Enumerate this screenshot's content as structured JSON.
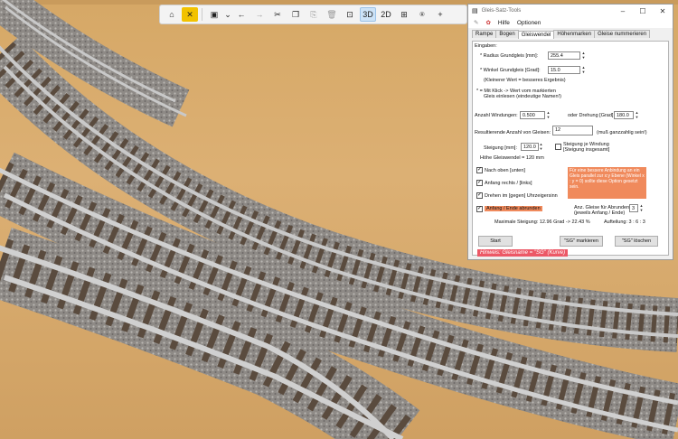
{
  "toolbar": {
    "buttons": [
      "home-icon",
      "tools-icon",
      "save-icon",
      "chevron-down-icon",
      "undo-arrow-icon",
      "redo-arrow-icon",
      "cut-icon",
      "copy-icon",
      "paste-icon",
      "chevron-down-icon",
      "delete-icon",
      "snap-icon"
    ],
    "view_3d": "3D",
    "view_2d": "2D",
    "accent": "#f2c200"
  },
  "window": {
    "title": "Gleis-Satz-Tools",
    "menu": [
      "Hilfe",
      "Optionen"
    ],
    "tabs": [
      "Rampe",
      "Bogen",
      "Gleiswendel",
      "Höhenmarken",
      "Gleise nummerieren"
    ],
    "active_tab": "Gleiswendel"
  },
  "form": {
    "eingaben": "Eingaben:",
    "radius_label": "* Radius Grundgleis [mm]:",
    "radius_value": "255.4",
    "winkel_label": "* Winkel Grundgleis [Grad]:",
    "winkel_value": "15.0",
    "winkel_hint": "(Kleinerer  Wert = besseres Ergebnis)",
    "klick_hint_1": "* = Mit Klick -> Wert vom markierten",
    "klick_hint_2": "Gleis einlesen (eindeutige Namen!)",
    "windungen_label": "Anzahl Windungen:",
    "windungen_value": "0.500",
    "oder_label": "oder  Drehung [Grad]:",
    "drehung_value": "180.0",
    "resultierende_label": "Resultierende Anzahl von Gleisen:",
    "resultierende_value": "12",
    "ganzzahlig_hint": "(muß ganzzahlig sein!)",
    "steigung_label": "Steigung [mm]:",
    "steigung_value": "120.0",
    "steigung_je_1": "Steigung je Windung",
    "steigung_je_2": "[Steigung insgesamt]",
    "hoehe_label": "Höhe Gleiswendel = 120 mm",
    "nach_oben": "Nach oben [unten]",
    "anfang_rechts": "Anfang rechts / [links]",
    "drehen": "Drehen im [gegen] Uhrzeigersinn",
    "anfang_ende": "Anfang / Ende  abrunden",
    "note": "Für eine bessere Anbindung an ein Gleis parallel zur x:y Ebene (Winkel x : y = 0) sollte diese Option gesetzt sein.",
    "abrunden_label_1": "Anz. Gleise für Abrunden",
    "abrunden_label_2": "(jeweils Anfang / Ende)",
    "abrunden_value": "3",
    "max_steigung": "Maximale Steigung:  12.96 Grad -> 22.43 %",
    "aufteilung": "Aufteilung:  3 : 6 : 3",
    "start_button": "Start",
    "markieren_button": "\"SG\" markieren",
    "loeschen_button": "\"SG\" löschen",
    "hinweis": "Hinweis: Gleisname = \"SG\" (Kurve)",
    "check_color": "#111111"
  }
}
